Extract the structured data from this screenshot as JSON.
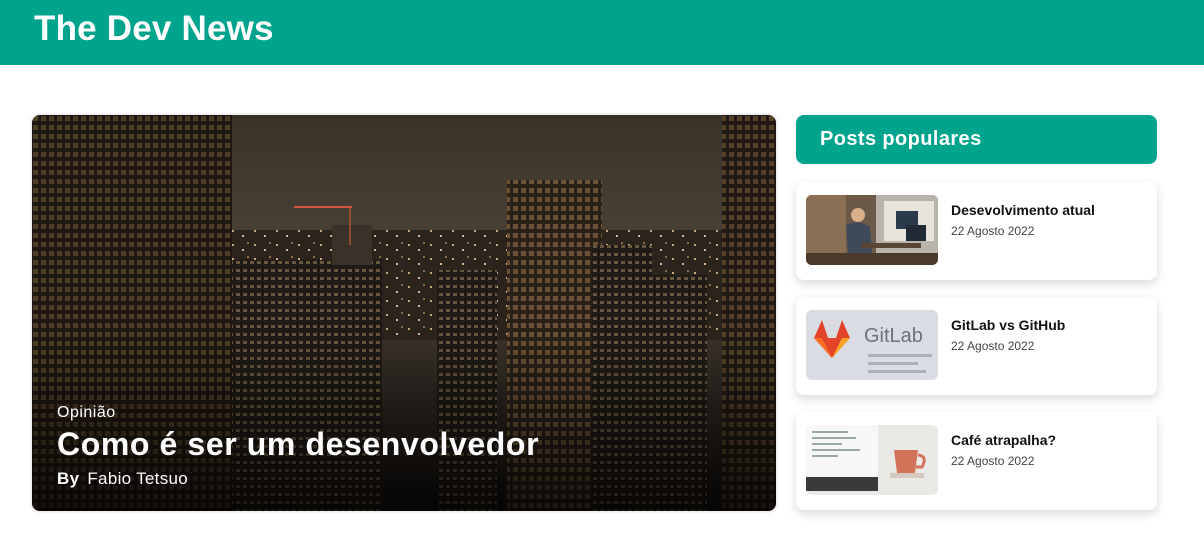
{
  "header": {
    "title": "The Dev News"
  },
  "featured": {
    "category": "Opinião",
    "title": "Como é ser um desenvolvedor",
    "by_label": "By",
    "author": "Fabio Tetsuo",
    "image_icon": "city-skyline-night-image"
  },
  "sidebar": {
    "heading": "Posts populares",
    "posts": [
      {
        "title": "Desevolvimento atual",
        "date": "22 Agosto 2022",
        "image_icon": "developer-at-desk-image"
      },
      {
        "title": "GitLab vs GitHub",
        "date": "22 Agosto 2022",
        "image_icon": "gitlab-logo-image",
        "image_text": "GitLab"
      },
      {
        "title": "Café atrapalha?",
        "date": "22 Agosto 2022",
        "image_icon": "coffee-cup-laptop-image"
      }
    ]
  },
  "colors": {
    "brand": "#00a48c",
    "text": "#111111",
    "muted": "#444444"
  }
}
